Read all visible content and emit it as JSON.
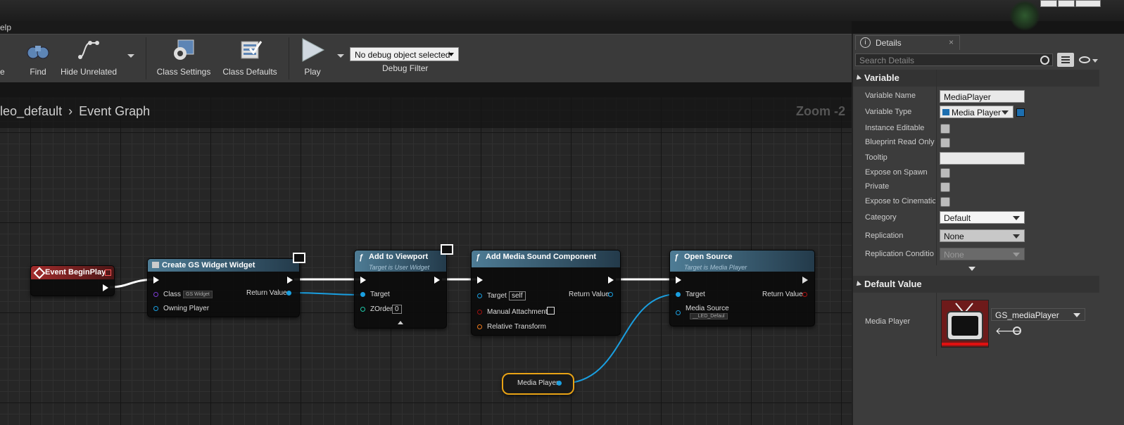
{
  "menu": {
    "help_label": "elp"
  },
  "toolbar": {
    "partial_label": "e",
    "find_label": "Find",
    "hide_unrelated_label": "Hide Unrelated",
    "class_settings_label": "Class Settings",
    "class_defaults_label": "Class Defaults",
    "play_label": "Play",
    "debug_selected": "No debug object selected",
    "debug_filter_label": "Debug Filter"
  },
  "graph": {
    "breadcrumb_parent": "leo_default",
    "breadcrumb_sep": "›",
    "breadcrumb_current": "Event Graph",
    "zoom": "Zoom -2"
  },
  "nodes": {
    "begin_play": {
      "title": "Event BeginPlay"
    },
    "create_widget": {
      "title": "Create GS Widget Widget",
      "class_label": "Class",
      "class_value": "GS Widget",
      "owning_player_label": "Owning Player",
      "return_label": "Return Value"
    },
    "add_viewport": {
      "title": "Add to Viewport",
      "subtitle": "Target is User Widget",
      "target_label": "Target",
      "zorder_label": "ZOrder",
      "zorder_value": "0"
    },
    "add_media_sound": {
      "title": "Add Media Sound Component",
      "target_label": "Target",
      "target_value": "self",
      "manual_attachment_label": "Manual Attachment",
      "relative_transform_label": "Relative Transform",
      "return_label": "Return Value"
    },
    "open_source": {
      "title": "Open Source",
      "subtitle": "Target is Media Player",
      "target_label": "Target",
      "media_source_label": "Media Source",
      "media_source_value": "__LED_Defaul",
      "return_label": "Return Value"
    },
    "media_player_var": {
      "label": "Media Player"
    }
  },
  "details": {
    "tab_label": "Details",
    "search_placeholder": "Search Details",
    "variable_section": "Variable",
    "props": {
      "variable_name_label": "Variable Name",
      "variable_name_value": "MediaPlayer",
      "variable_type_label": "Variable Type",
      "variable_type_value": "Media Player",
      "instance_editable_label": "Instance Editable",
      "blueprint_read_only_label": "Blueprint Read Only",
      "tooltip_label": "Tooltip",
      "expose_on_spawn_label": "Expose on Spawn",
      "private_label": "Private",
      "expose_cinematics_label": "Expose to Cinematic",
      "category_label": "Category",
      "category_value": "Default",
      "replication_label": "Replication",
      "replication_value": "None",
      "replication_condition_label": "Replication Conditio",
      "replication_condition_value": "None"
    },
    "default_value_section": "Default Value",
    "media_player_label": "Media Player",
    "media_player_asset": "GS_mediaPlayer"
  },
  "colors": {
    "exec_wire": "#ffffff",
    "object_wire": "#1a9fe0",
    "node_header_blue": "#4e7c95",
    "event_header_red": "#a22c2c",
    "selection_orange": "#e8a215"
  }
}
